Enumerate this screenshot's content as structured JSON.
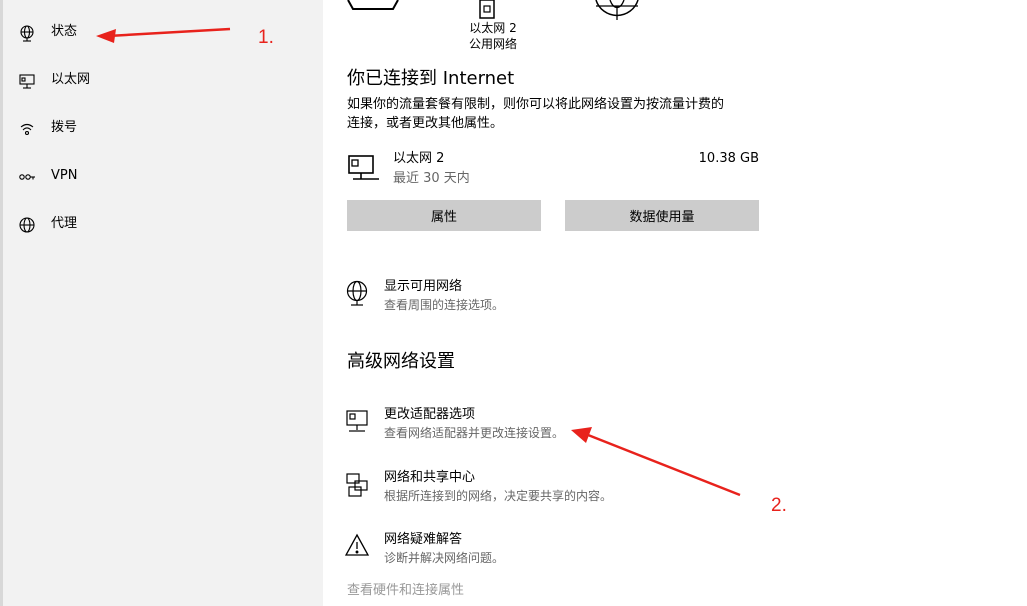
{
  "sidebar": {
    "items": [
      {
        "label": "状态",
        "icon": "globe-status-icon"
      },
      {
        "label": "以太网",
        "icon": "ethernet-icon"
      },
      {
        "label": "拨号",
        "icon": "dialup-icon"
      },
      {
        "label": "VPN",
        "icon": "vpn-icon"
      },
      {
        "label": "代理",
        "icon": "globe-proxy-icon"
      }
    ]
  },
  "diagram": {
    "network_name": "以太网 2",
    "network_type": "公用网络"
  },
  "status": {
    "heading": "你已连接到 Internet",
    "description_line1": "如果你的流量套餐有限制，则你可以将此网络设置为按流量计费的",
    "description_line2": "连接，或者更改其他属性。"
  },
  "connection": {
    "name": "以太网 2",
    "period": "最近 30 天内",
    "usage": "10.38 GB"
  },
  "buttons": {
    "properties": "属性",
    "data_usage": "数据使用量"
  },
  "show_networks": {
    "title": "显示可用网络",
    "subtitle": "查看周围的连接选项。"
  },
  "advanced": {
    "heading": "高级网络设置",
    "items": [
      {
        "title": "更改适配器选项",
        "subtitle": "查看网络适配器并更改连接设置。"
      },
      {
        "title": "网络和共享中心",
        "subtitle": "根据所连接到的网络，决定要共享的内容。"
      },
      {
        "title": "网络疑难解答",
        "subtitle": "诊断并解决网络问题。"
      }
    ],
    "footer_link": "查看硬件和连接属性"
  },
  "annotations": {
    "step1": "1.",
    "step2": "2.",
    "arrow_color": "#e8221c"
  }
}
